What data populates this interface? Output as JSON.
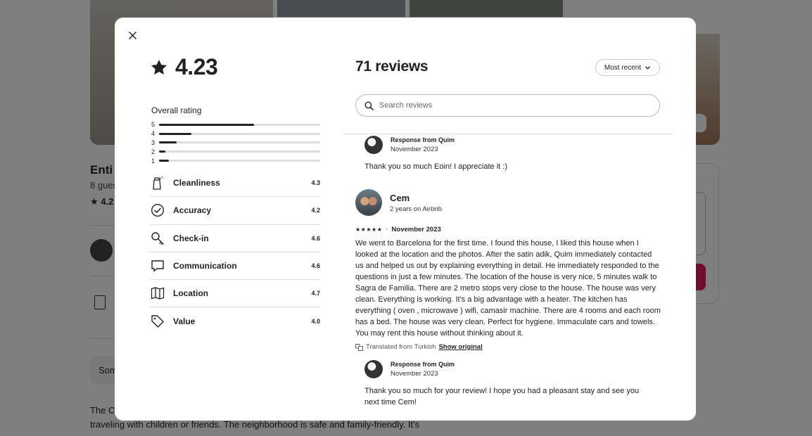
{
  "background": {
    "host_name": "",
    "listing_title": "Enti",
    "guests": "8 gues",
    "rating_short": "4.2",
    "some_button": "Som",
    "description": "The C bathrooms flat, located at the heart of Barcelona's City Center, perfect for those traveling with children or friends. The neighborhood is safe and family-friendly. It's"
  },
  "modal": {
    "overall_score": "4.23",
    "overall_label": "Overall rating",
    "distribution": [
      {
        "stars": "5",
        "fraction": 0.59
      },
      {
        "stars": "4",
        "fraction": 0.2
      },
      {
        "stars": "3",
        "fraction": 0.11
      },
      {
        "stars": "2",
        "fraction": 0.04
      },
      {
        "stars": "1",
        "fraction": 0.06
      }
    ],
    "categories": [
      {
        "icon": "spray-bottle-icon",
        "name": "Cleanliness",
        "value": "4.3"
      },
      {
        "icon": "check-circle-icon",
        "name": "Accuracy",
        "value": "4.2"
      },
      {
        "icon": "key-icon",
        "name": "Check-in",
        "value": "4.6"
      },
      {
        "icon": "chat-bubble-icon",
        "name": "Communication",
        "value": "4.6"
      },
      {
        "icon": "map-icon",
        "name": "Location",
        "value": "4.7"
      },
      {
        "icon": "tag-icon",
        "name": "Value",
        "value": "4.0"
      }
    ],
    "reviews_count": "71 reviews",
    "sort_label": "Most recent",
    "search_placeholder": "Search reviews",
    "response1": {
      "from": "Response from Quim",
      "date": "November 2023",
      "text": "Thank you so much Eoin! I appreciate it :)"
    },
    "review": {
      "name": "Cem",
      "tenure": "2 years on Airbnb",
      "stars": "★★★★★",
      "date": "November 2023",
      "text": "We went to Barcelona for the first time. I found this house, I liked this house when I looked at the location and the photos. After the satin adik, Quim immediately contacted us and helped us out by explaining everything in detail. He immediately responded to the questions in just a few minutes. The location of the house is very nice, 5 minutes walk to Sagra de Familia. There are 2 metro stops very close to the house. The house was very clean. Everything is working. It's a big advantage with a heater. The kitchen has everything ( oven , microwave ) wifi, camasir machine. There are 4 rooms and each room has a bed. The house was very clean. Perfect for hygiene. Immaculate cars and towels. You may rent this house without thinking about it.",
      "translated": "Translated from Turkish",
      "show_original": "Show original"
    },
    "response2": {
      "from": "Response from Quim",
      "date": "November 2023",
      "text": "Thank you so much for your review! I hope you had a pleasant stay and see you next time Cem!"
    }
  }
}
